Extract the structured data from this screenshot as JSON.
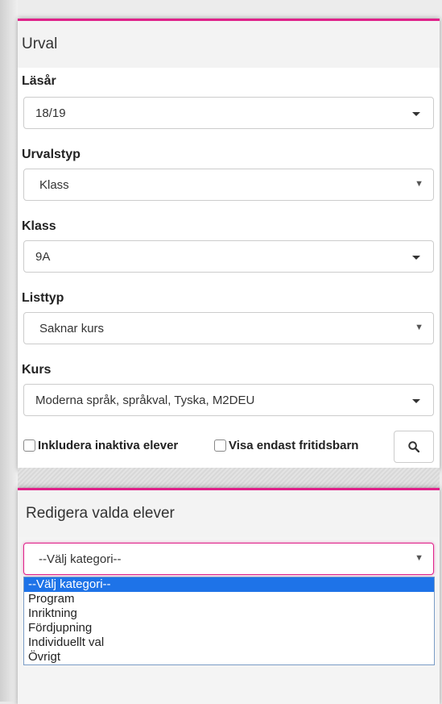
{
  "panel_selection": {
    "title": "Urval",
    "fields": [
      {
        "label": "Läsår",
        "value": "18/19"
      },
      {
        "label": "Urvalstyp",
        "value": "Klass"
      },
      {
        "label": "Klass",
        "value": "9A"
      },
      {
        "label": "Listtyp",
        "value": "Saknar kurs"
      },
      {
        "label": "Kurs",
        "value": "Moderna språk, språkval, Tyska, M2DEU"
      }
    ],
    "checkboxes": [
      {
        "label": "Inkludera inaktiva elever",
        "checked": false
      },
      {
        "label": "Visa endast fritidsbarn",
        "checked": false
      }
    ],
    "search_icon": "search-icon"
  },
  "panel_edit": {
    "title": "Redigera valda elever",
    "category_select": {
      "value": "--Välj kategori--",
      "options": [
        "--Välj kategori--",
        "Program",
        "Inriktning",
        "Fördjupning",
        "Individuellt val",
        "Övrigt"
      ],
      "selected_index": 0
    }
  },
  "colors": {
    "accent": "#e0218a",
    "highlight": "#1e73e8"
  }
}
